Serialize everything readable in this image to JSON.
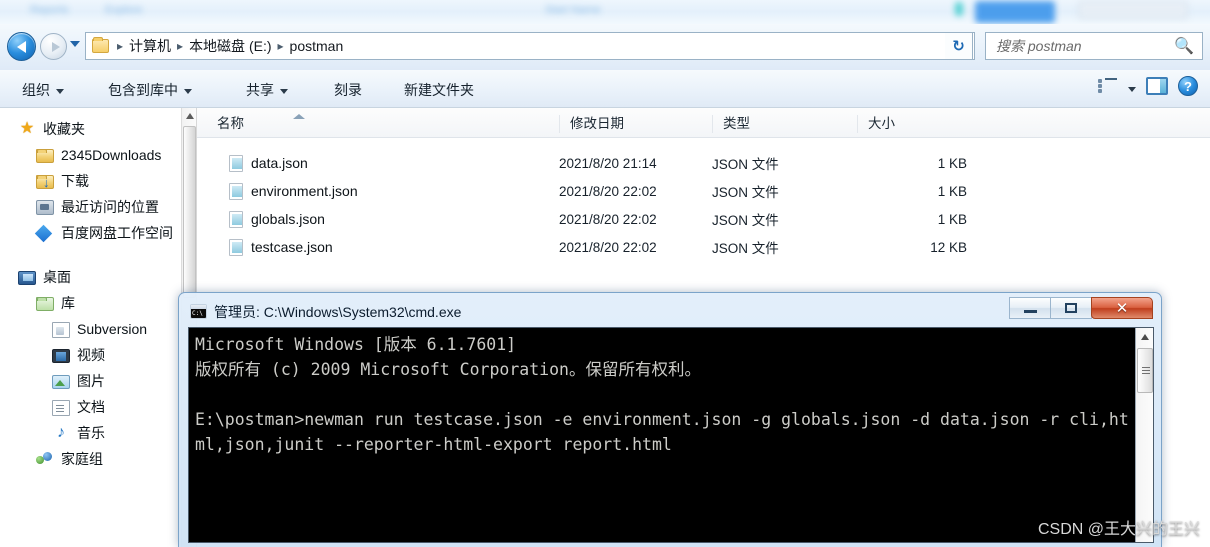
{
  "background_window": {
    "fragments": [
      "Reports",
      "Explore",
      "Start Name"
    ]
  },
  "explorer": {
    "address_bar": {
      "back_icon": "back-arrow-icon",
      "forward_icon": "forward-arrow-icon",
      "history_icon": "chevron-down-icon",
      "folder_icon": "folder-icon",
      "separator": "▸",
      "breadcrumbs": [
        "计算机",
        "本地磁盘 (E:)",
        "postman"
      ],
      "dropdown_icon": "chevron-down-icon",
      "refresh_label": "↻",
      "refresh_icon": "refresh-icon"
    },
    "search": {
      "placeholder": "搜索 postman",
      "icon": "search-icon"
    },
    "toolbar": {
      "items": [
        {
          "label": "组织",
          "caret": true
        },
        {
          "label": "包含到库中",
          "caret": true
        },
        {
          "label": "共享",
          "caret": true
        },
        {
          "label": "刻录",
          "caret": false
        },
        {
          "label": "新建文件夹",
          "caret": false
        }
      ],
      "view_icon": "view-list-icon",
      "view_caret_icon": "chevron-down-icon",
      "preview_pane_icon": "preview-pane-icon",
      "help_icon": "help-icon",
      "help_label": "?"
    },
    "nav_pane": {
      "items": [
        {
          "label": "收藏夹",
          "icon": "star-icon",
          "level": 0
        },
        {
          "label": "2345Downloads",
          "icon": "folder-icon",
          "level": 1
        },
        {
          "label": "下载",
          "icon": "folder-download-icon",
          "level": 1
        },
        {
          "label": "最近访问的位置",
          "icon": "recent-places-icon",
          "level": 1
        },
        {
          "label": "百度网盘工作空间",
          "icon": "baidu-netdisk-icon",
          "level": 1
        },
        {
          "label": "桌面",
          "icon": "desktop-icon",
          "level": 0
        },
        {
          "label": "库",
          "icon": "library-folder-icon",
          "level": 1
        },
        {
          "label": "Subversion",
          "icon": "subversion-icon",
          "level": 2
        },
        {
          "label": "视频",
          "icon": "video-icon",
          "level": 2
        },
        {
          "label": "图片",
          "icon": "picture-icon",
          "level": 2
        },
        {
          "label": "文档",
          "icon": "document-icon",
          "level": 2
        },
        {
          "label": "音乐",
          "icon": "music-icon",
          "level": 2
        },
        {
          "label": "家庭组",
          "icon": "homegroup-icon",
          "level": 1
        }
      ],
      "scrollbar_up_icon": "scroll-up-arrow-icon"
    },
    "file_list": {
      "columns": [
        "名称",
        "修改日期",
        "类型",
        "大小"
      ],
      "sort_column": "名称",
      "sort_indicator_icon": "sort-ascending-icon",
      "rows": [
        {
          "name": "data.json",
          "date": "2021/8/20 21:14",
          "type": "JSON 文件",
          "size": "1 KB",
          "icon": "json-file-icon"
        },
        {
          "name": "environment.json",
          "date": "2021/8/20 22:02",
          "type": "JSON 文件",
          "size": "1 KB",
          "icon": "json-file-icon"
        },
        {
          "name": "globals.json",
          "date": "2021/8/20 22:02",
          "type": "JSON 文件",
          "size": "1 KB",
          "icon": "json-file-icon"
        },
        {
          "name": "testcase.json",
          "date": "2021/8/20 22:02",
          "type": "JSON 文件",
          "size": "12 KB",
          "icon": "json-file-icon"
        }
      ]
    }
  },
  "cmd_window": {
    "icon": "cmd-console-icon",
    "title": "管理员: C:\\Windows\\System32\\cmd.exe",
    "minimize_icon": "minimize-icon",
    "maximize_icon": "maximize-icon",
    "close_icon": "close-icon",
    "close_label": "✕",
    "console_text": "Microsoft Windows [版本 6.1.7601]\n版权所有 (c) 2009 Microsoft Corporation。保留所有权利。\n\nE:\\postman>newman run testcase.json -e environment.json -g globals.json -d data.json -r cli,html,json,junit --reporter-html-export report.html",
    "scrollbar_up_icon": "scroll-up-arrow-icon"
  },
  "watermark": {
    "text": "CSDN @王大兴的王兴"
  },
  "colors": {
    "accent": "#2a8ede",
    "window_chrome": "#e2eefa",
    "console_bg": "#000000",
    "console_fg": "#ccccc8",
    "close_button": "#bf3d1c"
  }
}
